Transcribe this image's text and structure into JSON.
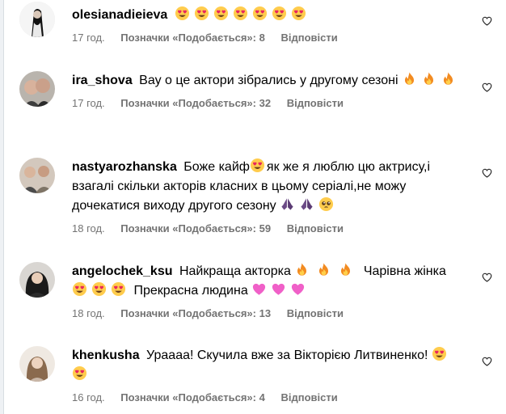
{
  "comments": [
    {
      "username": "olesianadieieva",
      "text": "",
      "time": "17 год.",
      "likes": "Позначки «Подобається»: 8",
      "reply": "Відповісти",
      "emojis_after": [
        "heart-eyes",
        "heart-eyes",
        "heart-eyes",
        "heart-eyes",
        "heart-eyes",
        "heart-eyes",
        "heart-eyes"
      ]
    },
    {
      "username": "ira_shova",
      "text": "Вау о це актори зібрались у другому сезоні",
      "time": "17 год.",
      "likes": "Позначки «Подобається»: 32",
      "reply": "Відповісти",
      "emojis_after": [
        "fire",
        "fire",
        "fire"
      ]
    },
    {
      "username": "nastyarozhanska",
      "text_a": "Боже кайф",
      "text_b": "як же я люблю цю актрису,і взагалі скільки акторів класних в цьому серіалі,не можу дочекатися виходу другого сезону",
      "time": "18 год.",
      "likes": "Позначки «Подобається»: 59",
      "reply": "Відповісти",
      "emojis_mid": [
        "heart-eyes"
      ],
      "emojis_after": [
        "praying-hands",
        "praying-hands",
        "pleading-face"
      ]
    },
    {
      "username": "angelochek_ksu",
      "text_a": "Найкраща акторка",
      "text_b": "Чарівна жінка",
      "text_c": "Прекрасна людина",
      "time": "18 год.",
      "likes": "Позначки «Подобається»: 13",
      "reply": "Відповісти",
      "emojis_a": [
        "fire",
        "fire",
        "fire"
      ],
      "emojis_b": [
        "heart-eyes",
        "heart-eyes",
        "heart-eyes"
      ],
      "emojis_c": [
        "pink-heart",
        "pink-heart",
        "pink-heart"
      ]
    },
    {
      "username": "khenkusha",
      "text": "Ураааа! Скучила вже за Вікторією Литвиненко!",
      "time": "16 год.",
      "likes": "Позначки «Подобається»: 4",
      "reply": "Відповісти",
      "emojis_after": [
        "heart-eyes",
        "heart-eyes"
      ]
    }
  ],
  "colors": {
    "meta_text": "#737373",
    "fire": "#f28b21",
    "heart_eyes_face": "#ffcc4d",
    "heart_eyes_eyes": "#e8265e",
    "pink_heart": "#f060c8",
    "praying_hands": "#6b4a86"
  }
}
